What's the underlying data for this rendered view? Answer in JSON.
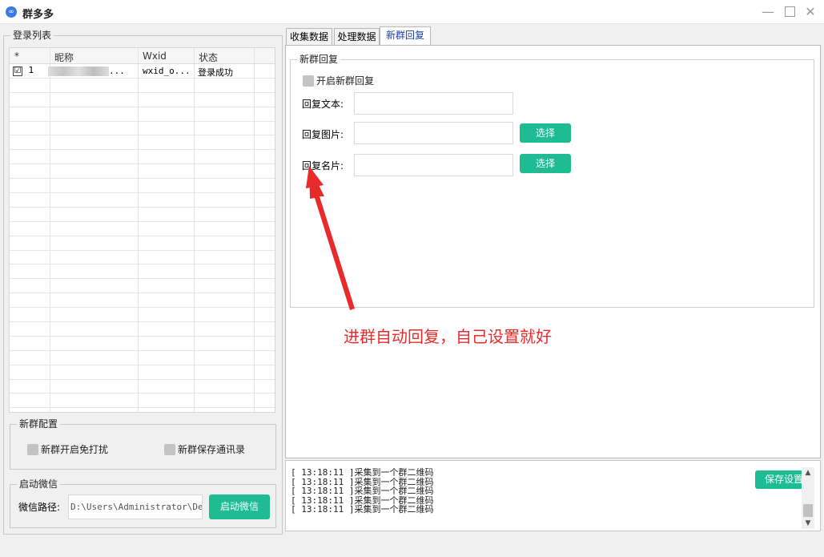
{
  "window": {
    "title": "群多多",
    "icon": "link-icon"
  },
  "login_list": {
    "legend": "登录列表",
    "columns": [
      "*",
      "昵称",
      "Wxid",
      "状态"
    ],
    "rows": [
      {
        "index": "1",
        "checked": "☑",
        "nickname_suffix": "...",
        "wxid": "wxid_o...",
        "status": "登录成功"
      }
    ]
  },
  "new_group_config": {
    "legend": "新群配置",
    "mute_label": "新群开启免打扰",
    "save_contacts_label": "新群保存通讯录"
  },
  "launch_wechat": {
    "legend": "启动微信",
    "path_label": "微信路径:",
    "path_value": "D:\\Users\\Administrator\\Desktop",
    "launch_button": "启动微信"
  },
  "tabs": [
    {
      "label": "收集数据",
      "active": false
    },
    {
      "label": "处理数据",
      "active": false
    },
    {
      "label": "新群回复",
      "active": true
    }
  ],
  "new_group_reply": {
    "legend": "新群回复",
    "enable_label": "开启新群回复",
    "reply_text_label": "回复文本:",
    "reply_image_label": "回复图片:",
    "reply_card_label": "回复名片:",
    "select_label": "选择"
  },
  "annotation": {
    "text": "进群自动回复，自己设置就好",
    "color": "#e82a2a"
  },
  "log": {
    "lines": [
      "[ 13:18:11 ]采集到一个群二维码",
      "[ 13:18:11 ]采集到一个群二维码",
      "[ 13:18:11 ]采集到一个群二维码",
      "[ 13:18:11 ]采集到一个群二维码",
      "[ 13:18:11 ]采集到一个群二维码"
    ],
    "save_button": "保存设置"
  },
  "colors": {
    "accent_button": "#1fbc94",
    "active_tab_text": "#1a3ea8"
  }
}
